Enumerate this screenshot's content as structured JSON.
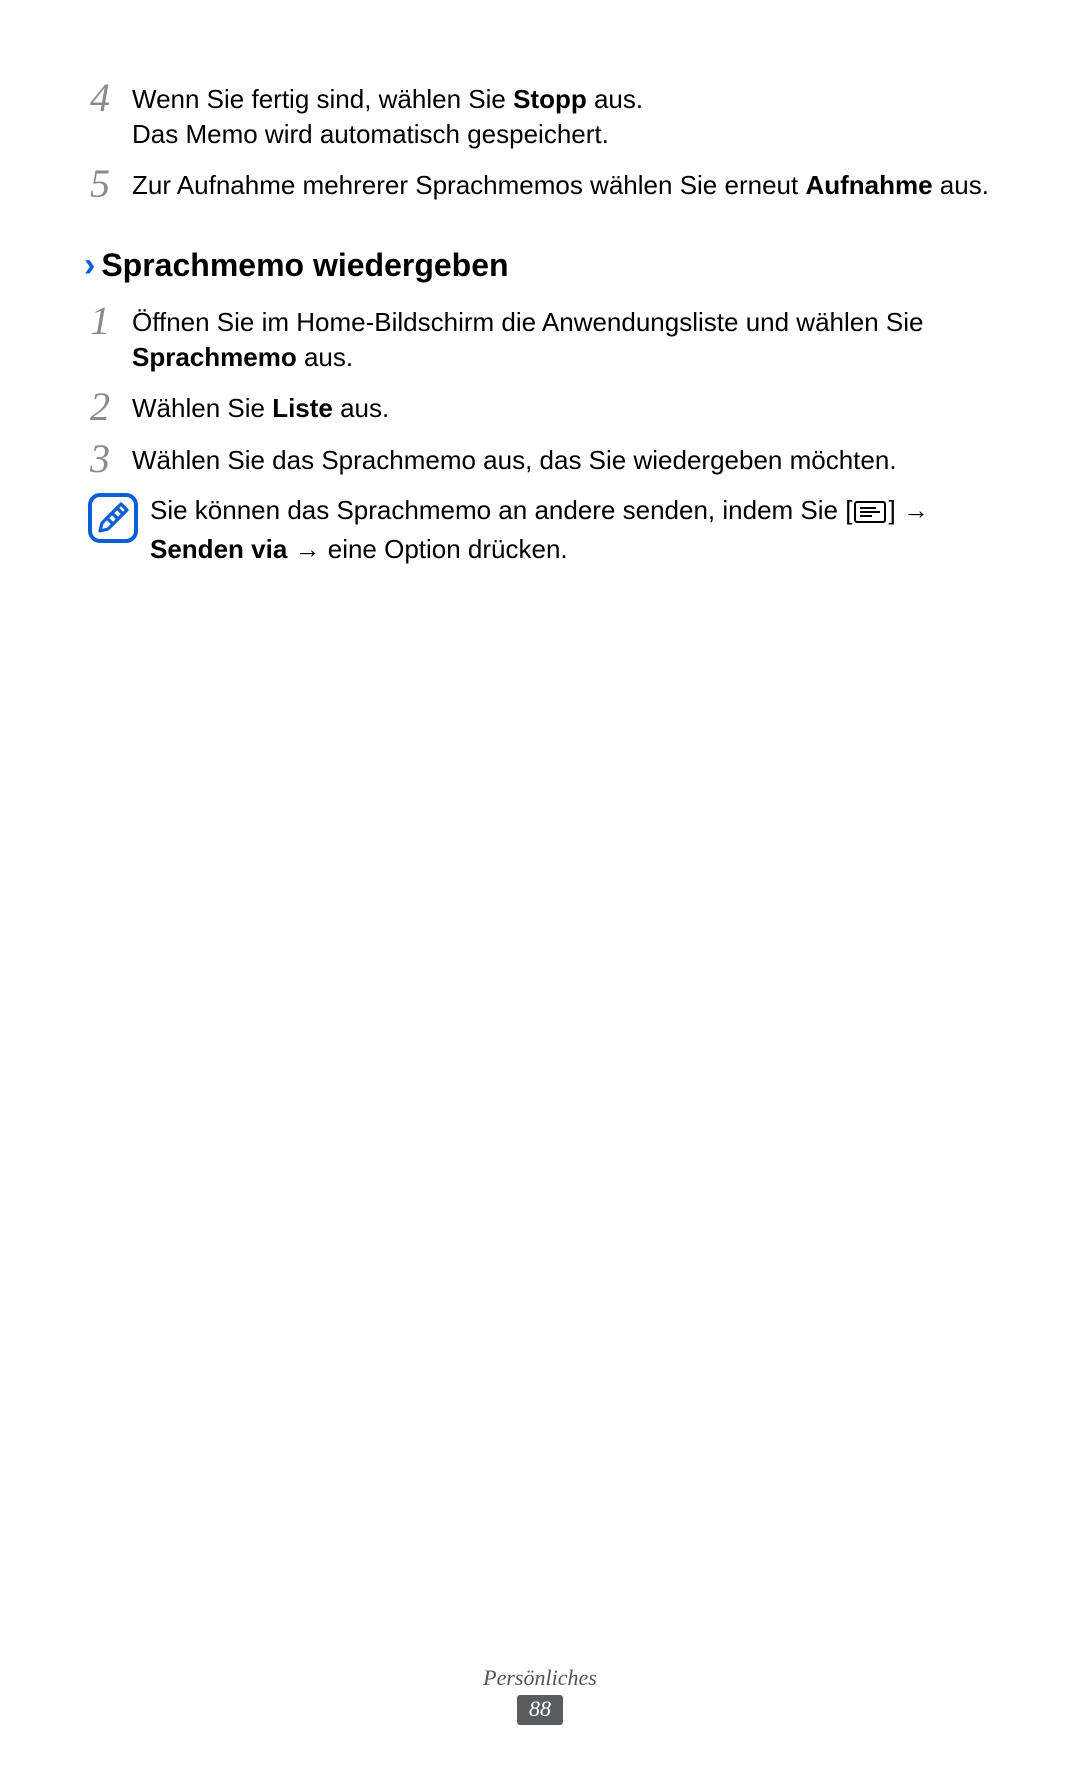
{
  "top_steps": [
    {
      "num": "4",
      "html": "Wenn Sie fertig sind, wählen Sie <b>Stopp</b> aus.<br>Das Memo wird automatisch gespeichert."
    },
    {
      "num": "5",
      "html": "Zur Aufnahme mehrerer Sprachmemos wählen Sie erneut <b>Aufnahme</b> aus."
    }
  ],
  "section": {
    "chevron": "›",
    "title": "Sprachmemo wiedergeben"
  },
  "section_steps": [
    {
      "num": "1",
      "html": "Öffnen Sie im Home-Bildschirm die Anwendungsliste und wählen Sie <b>Sprachmemo</b> aus."
    },
    {
      "num": "2",
      "html": "Wählen Sie <b>Liste</b> aus."
    },
    {
      "num": "3",
      "html": "Wählen Sie das Sprachmemo aus, das Sie wiedergeben möchten."
    }
  ],
  "note": {
    "pre": "Sie können das Sprachmemo an andere senden, indem Sie [",
    "mid1": "] → ",
    "bold": "Senden via",
    "mid2": " → eine Option drücken."
  },
  "footer": {
    "section": "Persönliches",
    "page": "88"
  }
}
